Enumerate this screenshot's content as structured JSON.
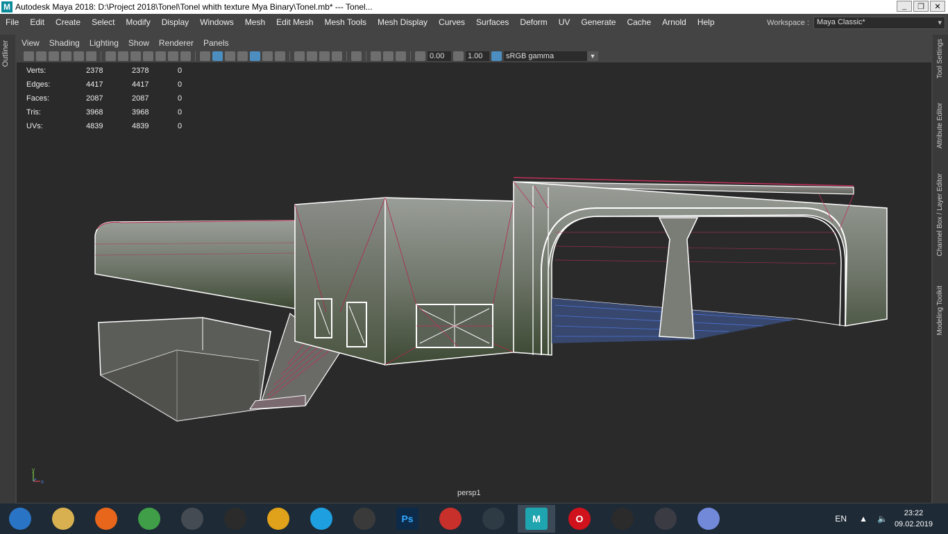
{
  "window": {
    "title": "Autodesk Maya 2018: D:\\Project 2018\\Tonel\\Tonel whith texture Mya Binary\\Tonel.mb*   ---   Tonel...",
    "icon": "maya-app-icon"
  },
  "menubar": [
    "File",
    "Edit",
    "Create",
    "Select",
    "Modify",
    "Display",
    "Windows",
    "Mesh",
    "Edit Mesh",
    "Mesh Tools",
    "Mesh Display",
    "Curves",
    "Surfaces",
    "Deform",
    "UV",
    "Generate",
    "Cache",
    "Arnold",
    "Help"
  ],
  "workspace": {
    "label": "Workspace :",
    "value": "Maya Classic*"
  },
  "left_panel": {
    "outliner": "Outliner"
  },
  "right_panel": [
    "Tool Settings",
    "Attribute Editor",
    "Channel Box / Layer Editor",
    "Modeling Toolkit"
  ],
  "panel_menu": [
    "View",
    "Shading",
    "Lighting",
    "Show",
    "Renderer",
    "Panels"
  ],
  "toolbar": {
    "exposure": "0.00",
    "gamma": "1.00",
    "colorspace": "sRGB gamma"
  },
  "hud": [
    {
      "label": "Verts:",
      "a": "2378",
      "b": "2378",
      "c": "0"
    },
    {
      "label": "Edges:",
      "a": "4417",
      "b": "4417",
      "c": "0"
    },
    {
      "label": "Faces:",
      "a": "2087",
      "b": "2087",
      "c": "0"
    },
    {
      "label": "Tris:",
      "a": "3968",
      "b": "3968",
      "c": "0"
    },
    {
      "label": "UVs:",
      "a": "4839",
      "b": "4839",
      "c": "0"
    }
  ],
  "viewport": {
    "camera": "persp1",
    "axis_y": "y",
    "axis_x": "x"
  },
  "taskbar": {
    "apps": [
      {
        "name": "start-button",
        "color": "#2a74c5"
      },
      {
        "name": "paint-app",
        "color": "#d8b050"
      },
      {
        "name": "firefox-app",
        "color": "#e8661b"
      },
      {
        "name": "chrome-app",
        "color": "#3f9e47"
      },
      {
        "name": "world-of-tanks-app",
        "color": "#444b52"
      },
      {
        "name": "quixel-app",
        "color": "#2b2b2b"
      },
      {
        "name": "artstation-app",
        "color": "#e0a21a"
      },
      {
        "name": "skype-app",
        "color": "#1ea0e0"
      },
      {
        "name": "zbrush-app",
        "color": "#3a3a3a"
      },
      {
        "name": "photoshop-app",
        "color": "#0d2a48"
      },
      {
        "name": "substance-painter-app",
        "color": "#c8302b"
      },
      {
        "name": "pixel-app",
        "color": "#2e3a44"
      },
      {
        "name": "maya-app",
        "color": "#1fa5b0"
      },
      {
        "name": "opera-app",
        "color": "#d0121c"
      },
      {
        "name": "unity-app",
        "color": "#2b2b2b"
      },
      {
        "name": "equalizer-app",
        "color": "#3b3b44"
      },
      {
        "name": "discord-app",
        "color": "#7289da"
      }
    ],
    "labels": {
      "ps": "Ps",
      "maya": "M",
      "opera": "O"
    },
    "lang": "EN",
    "time": "23:22",
    "date": "09.02.2019"
  }
}
